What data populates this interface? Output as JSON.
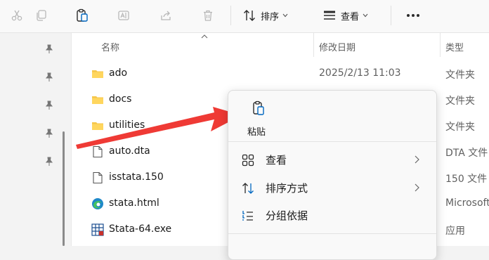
{
  "toolbar": {
    "sort_label": "排序",
    "view_label": "查看",
    "icons": [
      "scissors-icon",
      "copy-icon",
      "paste-icon",
      "rename-icon",
      "share-icon",
      "delete-icon",
      "sort-icon",
      "view-icon",
      "more-icon"
    ]
  },
  "columns": {
    "name": "名称",
    "modified": "修改日期",
    "type": "类型"
  },
  "files": [
    {
      "name": "ado",
      "date": "2025/2/13 11:03",
      "type": "文件夹",
      "icon": "folder-icon"
    },
    {
      "name": "docs",
      "date": "",
      "type": "文件夹",
      "icon": "folder-icon"
    },
    {
      "name": "utilities",
      "date": "",
      "type": "文件夹",
      "icon": "folder-icon"
    },
    {
      "name": "auto.dta",
      "date": "",
      "type": "DTA 文件",
      "icon": "file-icon"
    },
    {
      "name": "isstata.150",
      "date": "",
      "type": "150 文件",
      "icon": "file-icon"
    },
    {
      "name": "stata.html",
      "date": "",
      "type": "Microsoft",
      "icon": "edge-icon"
    },
    {
      "name": "Stata-64.exe",
      "date": "",
      "type": "应用",
      "icon": "app-icon"
    }
  ],
  "context_menu": {
    "paste_label": "粘贴",
    "items": [
      {
        "label": "查看",
        "icon": "grid-icon",
        "submenu": true
      },
      {
        "label": "排序方式",
        "icon": "sort-icon",
        "submenu": true
      },
      {
        "label": "分组依据",
        "icon": "group-icon",
        "submenu": false
      }
    ]
  },
  "colors": {
    "annotation_arrow": "#ef3a35",
    "folder": "#f6c64a",
    "accent": "#0067c0"
  }
}
